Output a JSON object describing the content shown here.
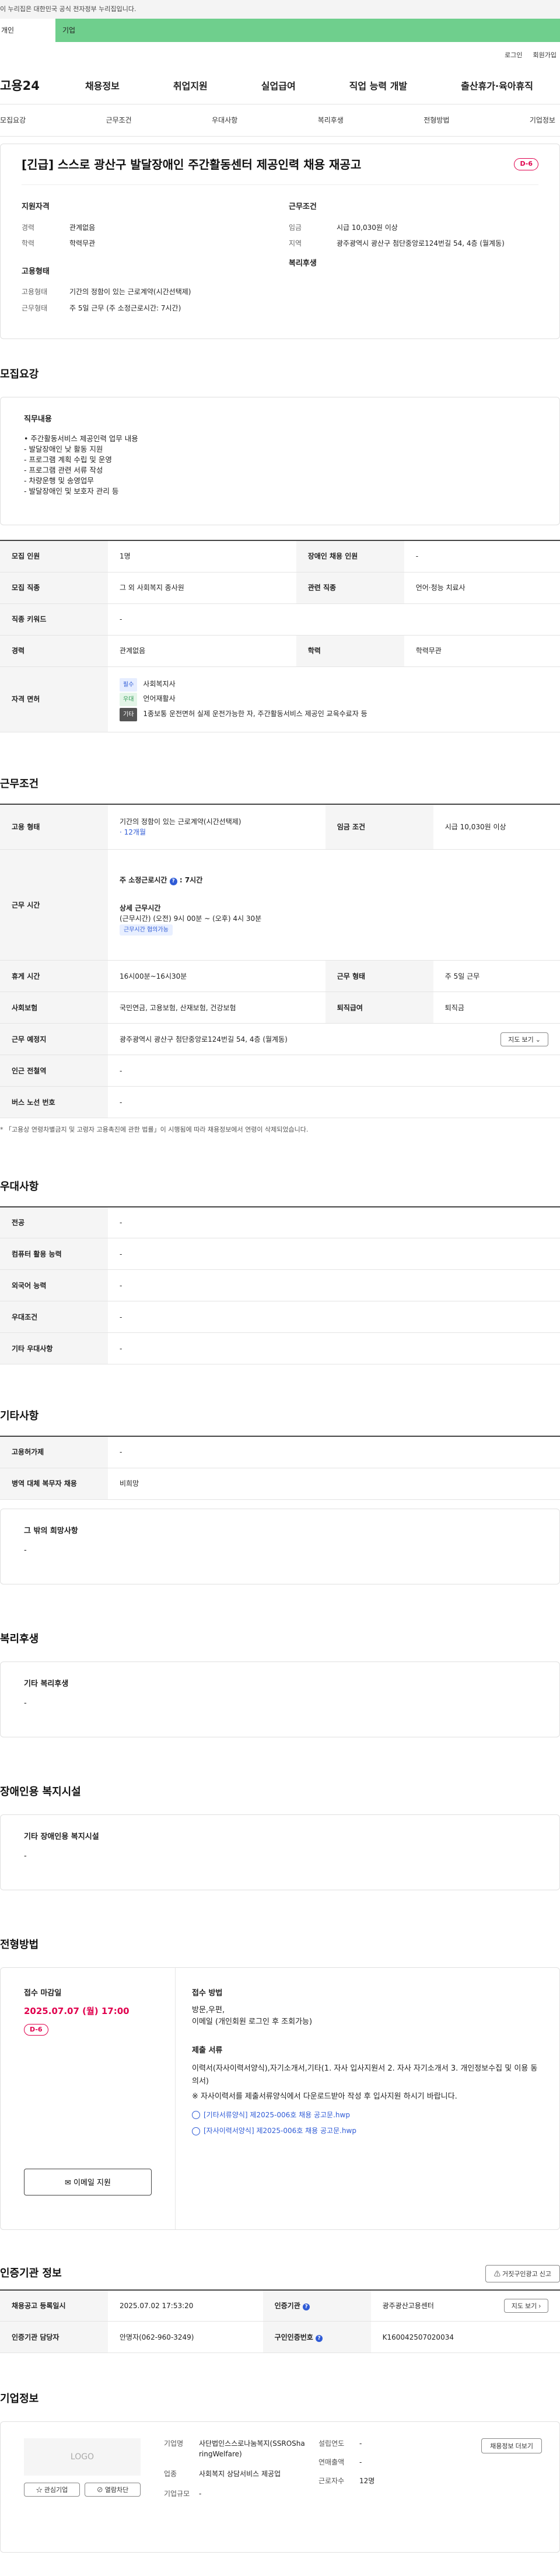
{
  "gov_banner": "이 누리집은 대한민국 공식 전자정부 누리집입니다.",
  "top_tabs": {
    "person": "개인",
    "corp": "기업"
  },
  "util": {
    "login": "로그인",
    "join": "회원가입"
  },
  "logo": "고용24",
  "gnb": [
    "채용정보",
    "취업지원",
    "실업급여",
    "직업 능력 개발",
    "출산휴가·육아휴직"
  ],
  "subnav": [
    "모집요강",
    "근무조건",
    "우대사항",
    "복리후생",
    "전형방법",
    "기업정보"
  ],
  "title": "[긴급] 스스로 광산구 발달장애인 주간활동센터 제공인력 채용 재공고",
  "dday": "D-6",
  "summary": {
    "qual_title": "지원자격",
    "career_label": "경력",
    "career": "관계없음",
    "edu_label": "학력",
    "edu": "학력무관",
    "emp_title": "고용형태",
    "emp_type_label": "고용형태",
    "emp_type": "기간의 정함이 있는 근로계약(시간선택제)",
    "work_type_label": "근무형태",
    "work_type": "주 5일 근무 (주 소정근로시간: 7시간)",
    "cond_title": "근무조건",
    "wage_label": "임금",
    "wage": "시급 10,030원 이상",
    "region_label": "지역",
    "region": "광주광역시 광산구 첨단중앙로124번길 54, 4층 (월계동)",
    "welfare_title": "복리후생"
  },
  "recruit": {
    "title": "모집요강",
    "duty_title": "직무내용",
    "duties": [
      "• 주간활동서비스 제공인력 업무 내용",
      "- 발달장애인 낮 활동 지원",
      "- 프로그램 계획 수립 및 운영",
      "- 프로그램 관련 서류 작성",
      "- 차량운행 및 송영업무",
      "- 발달장애인 및 보호자 관리 등"
    ],
    "r1": {
      "k1": "모집 인원",
      "v1": "1명",
      "k2": "장애인 채용 인원",
      "v2": "-"
    },
    "r2": {
      "k1": "모집 직종",
      "v1": "그 외 사회복지 종사원",
      "k2": "관련 직종",
      "v2": "언어·청능 치료사"
    },
    "r3": {
      "k1": "직종 키워드",
      "v1": "-"
    },
    "r4": {
      "k1": "경력",
      "v1": "관계없음",
      "k2": "학력",
      "v2": "학력무관"
    },
    "license_label": "자격 면허",
    "licenses": [
      {
        "tag": "필수",
        "name": "사회복지사"
      },
      {
        "tag": "우대",
        "name": "언어재활사"
      },
      {
        "tag": "기타",
        "name": "1종보통 운전면허 실제 운전가능한 자, 주간활동서비스 제공인 교육수료자 등"
      }
    ]
  },
  "conditions": {
    "title": "근무조건",
    "emp_label": "고용 형태",
    "emp_value": "기간의 정함이 있는 근로계약(시간선택제)",
    "emp_period": "· 12개월",
    "wage_label": "임금 조건",
    "wage_value": "시급 10,030원 이상",
    "time_label": "근무 시간",
    "hours_title": "주 소정근로시간",
    "hours_value": ": 7시간",
    "detail_title": "상세 근무시간",
    "detail_value": "(근무시간) (오전) 9시 00분 ~ (오후) 4시 30분",
    "detail_chip": "근무시간 협의가능",
    "break_label": "휴게 시간",
    "break_value": "16시00분~16시30분",
    "form_label": "근무 형태",
    "form_value": "주 5일 근무",
    "ins_label": "사회보험",
    "ins_value": "국민연금, 고용보험, 산재보험, 건강보험",
    "sev_label": "퇴직급여",
    "sev_value": "퇴직금",
    "place_label": "근무 예정지",
    "place_value": "광주광역시 광산구 첨단중앙로124번길 54, 4층 (월계동)",
    "map_btn": "지도 보기",
    "metro_label": "인근 전철역",
    "metro_value": "-",
    "bus_label": "버스 노선 번호",
    "bus_value": "-",
    "note": "* 「고용상 연령차별금지 및 고령자 고용촉진에 관한 법률」이 시행됨에 따라 채용정보에서 연령이 삭제되었습니다."
  },
  "pref": {
    "title": "우대사항",
    "rows": [
      {
        "k": "전공",
        "v": "-"
      },
      {
        "k": "컴퓨터 활용 능력",
        "v": "-"
      },
      {
        "k": "외국어 능력",
        "v": "-"
      },
      {
        "k": "우대조건",
        "v": "-"
      },
      {
        "k": "기타 우대사항",
        "v": "-"
      }
    ]
  },
  "etc": {
    "title": "기타사항",
    "rows": [
      {
        "k": "고용허가제",
        "v": "-"
      },
      {
        "k": "병역 대체 복무자 채용",
        "v": "비희망"
      }
    ],
    "hope_title": "그 밖의 희망사항",
    "hope_value": "-"
  },
  "welfare": {
    "title": "복리후생",
    "box_title": "기타 복리후생",
    "box_value": "-"
  },
  "disabled": {
    "title": "장애인용 복지시설",
    "box_title": "기타 장애인용 복지시설",
    "box_value": "-"
  },
  "process": {
    "title": "전형방법",
    "deadline_label": "접수 마감일",
    "deadline": "2025.07.07 (월) 17:00",
    "dday": "D-6",
    "email_btn": "이메일 지원",
    "method_title": "접수 방법",
    "method_value": "방문,우편,",
    "method_value2": "이메일 (개인회원 로그인 후 조회가능)",
    "docs_title": "제출 서류",
    "docs_value": "이력서(자사이력서양식),자기소개서,기타(1. 자사 입사지원서 2. 자사 자기소개서 3. 개인정보수집 및 이용 동의서)",
    "docs_note": "※ 자사이력서를 제출서류양식에서 다운로드받아 작성 후 입사지원 하시기 바랍니다.",
    "files": [
      "[기타서류양식] 제2025-006호 채용 공고문.hwp",
      "[자사이력서양식] 제2025-006호 채용 공고문.hwp"
    ]
  },
  "agency": {
    "title": "인증기관 정보",
    "report_btn": "거짓구인광고 신고",
    "reg_label": "채용공고 등록일시",
    "reg_value": "2025.07.02 17:53:20",
    "org_label": "인증기관",
    "org_value": "광주광산고용센터",
    "map_btn": "지도 보기",
    "mgr_label": "인증기관 담당자",
    "mgr_value": "안명자(062-960-3249)",
    "id_label": "구인인증번호",
    "id_value": "K160042507020034"
  },
  "company": {
    "title": "기업정보",
    "logo": "LOGO",
    "fav_btn": "관심기업",
    "block_btn": "열람차단",
    "name_label": "기업명",
    "name_value": "사단법인스스로나눔복지(SSROSharingWelfare)",
    "ind_label": "업종",
    "ind_value": "사회복지 상담서비스 제공업",
    "size_label": "기업규모",
    "size_value": "-",
    "est_label": "설립연도",
    "est_value": "-",
    "sales_label": "연매출액",
    "sales_value": "-",
    "emp_label": "근로자수",
    "emp_value": "12명",
    "more_btn": "채용정보 더보기"
  }
}
